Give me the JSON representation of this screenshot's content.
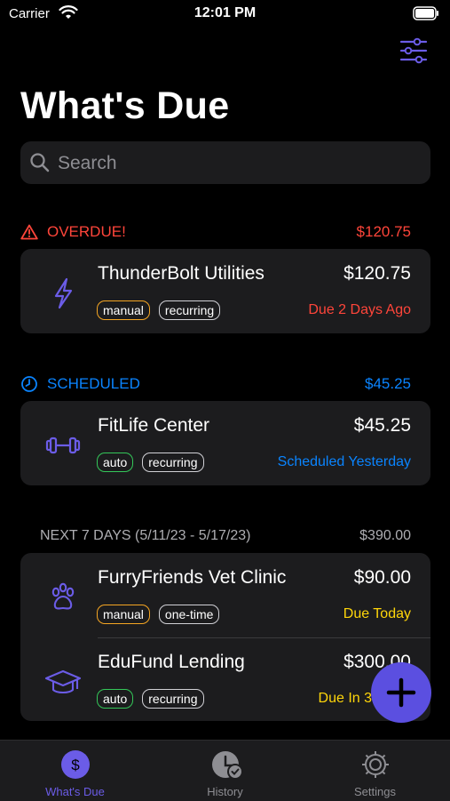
{
  "status_bar": {
    "carrier": "Carrier",
    "time": "12:01 PM"
  },
  "page_title": "What's Due",
  "search": {
    "placeholder": "Search"
  },
  "colors": {
    "accent": "#6b5ce7",
    "overdue": "#ff453a",
    "scheduled": "#0a84ff",
    "due_today": "#ffd60a",
    "manual_tag": "#f5a623",
    "auto_tag": "#34c759"
  },
  "sections": {
    "overdue": {
      "label": "OVERDUE!",
      "total": "$120.75",
      "icon": "warning-triangle-icon"
    },
    "scheduled": {
      "label": "SCHEDULED",
      "total": "$45.25",
      "icon": "clock-icon"
    },
    "next7": {
      "label": "NEXT 7 DAYS (5/11/23 - 5/17/23)",
      "total": "$390.00"
    }
  },
  "bills": [
    {
      "name": "ThunderBolt Utilities",
      "amount": "$120.75",
      "tags": [
        "manual",
        "recurring"
      ],
      "status": "Due 2 Days Ago",
      "icon": "lightning-bolt-icon"
    },
    {
      "name": "FitLife Center",
      "amount": "$45.25",
      "tags": [
        "auto",
        "recurring"
      ],
      "status": "Scheduled Yesterday",
      "icon": "dumbbell-icon"
    },
    {
      "name": "FurryFriends Vet Clinic",
      "amount": "$90.00",
      "tags": [
        "manual",
        "one-time"
      ],
      "status": "Due Today",
      "icon": "paw-icon"
    },
    {
      "name": "EduFund Lending",
      "amount": "$300.00",
      "tags": [
        "auto",
        "recurring"
      ],
      "status": "Due In 3",
      "icon": "graduation-cap-icon"
    }
  ],
  "tabs": [
    {
      "label": "What's Due",
      "icon": "dollar-circle-icon",
      "active": true
    },
    {
      "label": "History",
      "icon": "history-check-icon",
      "active": false
    },
    {
      "label": "Settings",
      "icon": "gear-icon",
      "active": false
    }
  ]
}
